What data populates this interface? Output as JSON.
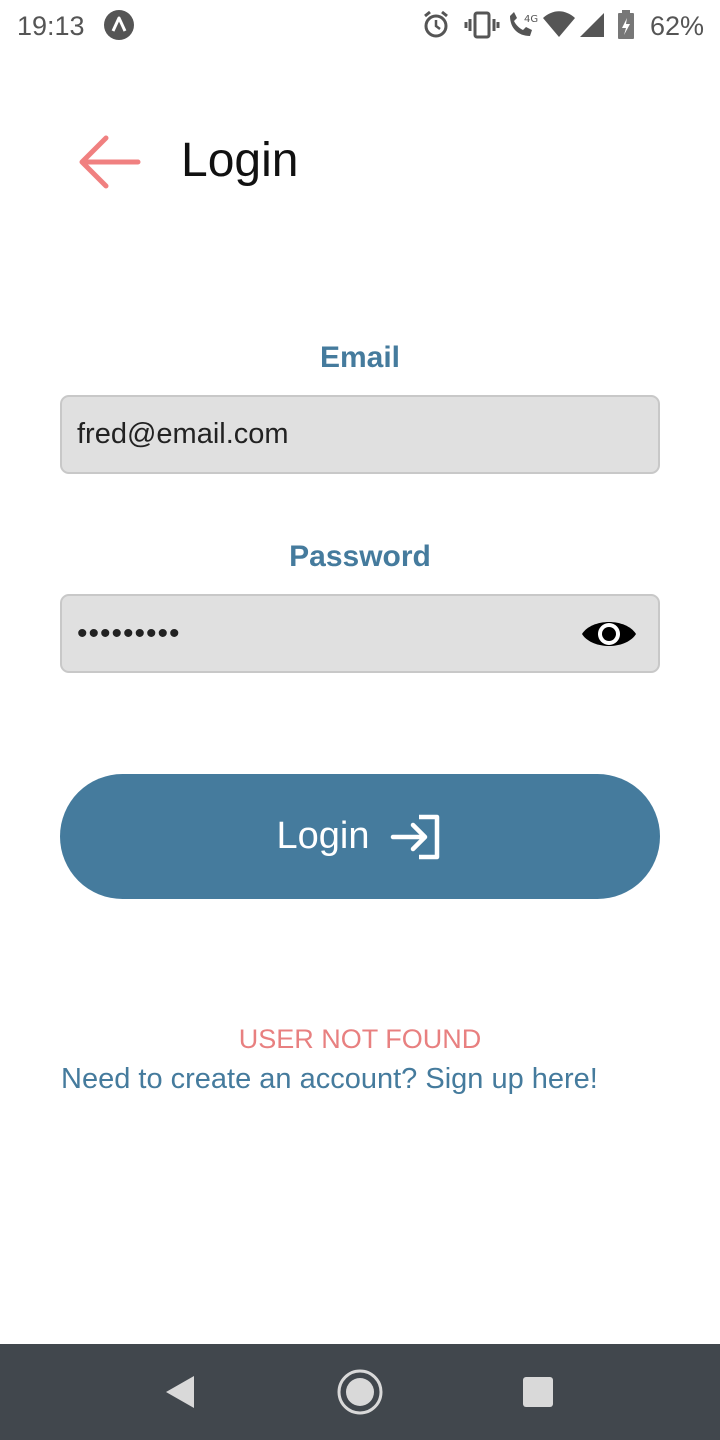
{
  "status_bar": {
    "time": "19:13",
    "battery_percent": "62%",
    "network_label": "4G",
    "icons": [
      "app-notification-icon",
      "alarm-icon",
      "vibrate-icon",
      "wifi-calling-icon",
      "wifi-icon",
      "signal-icon",
      "battery-icon"
    ]
  },
  "header": {
    "title": "Login",
    "back_icon": "arrow-left-icon",
    "back_color": "#f08080"
  },
  "form": {
    "email": {
      "label": "Email",
      "value": "fred@email.com"
    },
    "password": {
      "label": "Password",
      "value": "•••••••••",
      "toggle_icon": "eye-icon"
    },
    "submit": {
      "label": "Login",
      "icon": "login-icon"
    }
  },
  "error_message": "USER NOT FOUND",
  "signup_link": "Need to create an account? Sign up here!",
  "nav_bar": {
    "buttons": [
      "back-triangle-icon",
      "home-circle-icon",
      "recents-square-icon"
    ]
  },
  "colors": {
    "accent": "#457b9d",
    "error": "#e88080",
    "back_arrow": "#f08080",
    "input_bg": "#e0e0e0",
    "nav_bg": "#41474d"
  }
}
